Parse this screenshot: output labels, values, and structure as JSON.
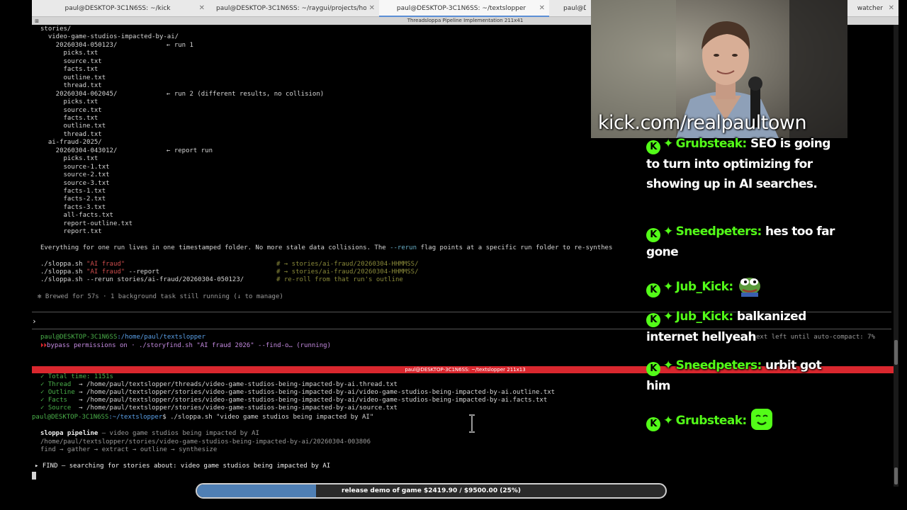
{
  "tabs": [
    {
      "label": "paul@DESKTOP-3C1N6SS: ~/kick",
      "active": false
    },
    {
      "label": "paul@DESKTOP-3C1N6SS: ~/raygui/projects/hoo...",
      "active": false
    },
    {
      "label": "paul@DESKTOP-3C1N6SS: ~/textslopper",
      "active": true
    },
    {
      "label": "paul@DE...",
      "active": false
    },
    {
      "label": "watcher",
      "active": false
    }
  ],
  "window_title": "Threadsloppa Pipeline Implementation 211x41",
  "top_pane": {
    "tree": [
      "stories/",
      "  video-game-studios-impacted-by-ai/",
      "    20260304-050123/",
      "      picks.txt",
      "      source.txt",
      "      facts.txt",
      "      outline.txt",
      "      thread.txt",
      "    20260304-062045/",
      "      picks.txt",
      "      source.txt",
      "      facts.txt",
      "      outline.txt",
      "      thread.txt",
      "  ai-fraud-2025/",
      "    20260304-043012/",
      "      picks.txt",
      "      source-1.txt",
      "      source-2.txt",
      "      source-3.txt",
      "      facts-1.txt",
      "      facts-2.txt",
      "      facts-3.txt",
      "      all-facts.txt",
      "      report-outline.txt",
      "      report.txt"
    ],
    "annotations": [
      {
        "row": 2,
        "text": "← run 1"
      },
      {
        "row": 8,
        "text": "← run 2 (different results, no collision)"
      },
      {
        "row": 15,
        "text": "← report run"
      }
    ],
    "summary_pre": "Everything for one run lives in one timestamped folder. No more stale data collisions. The ",
    "summary_flag": "--rerun",
    "summary_post": " flag points at a specific run folder to re-synthes",
    "commands": [
      {
        "cmd": "./sloppa.sh ",
        "arg": "\"AI fraud\"",
        "extra": "",
        "comment": "# → stories/ai-fraud/20260304-HHMMSS/"
      },
      {
        "cmd": "./sloppa.sh ",
        "arg": "\"AI fraud\"",
        "extra": " --report",
        "comment": "# → stories/ai-fraud/20260304-HHMMSS/"
      },
      {
        "cmd": "./sloppa.sh --rerun stories/ai-fraud/20260304-050123/",
        "arg": "",
        "extra": "",
        "comment": "# re-roll from that run's outline"
      }
    ],
    "brewed": "✻ Brewed for 57s · 1 background task still running (↓ to manage)",
    "prompt_symbol": "›",
    "ps_user": "paul@DESKTOP-3C1N6SS",
    "ps_path": ":/home/paul/textslopper",
    "bypass": "bypass permissions on · ./storyfind.sh \"AI fraud 2026\" --find-o… (running)",
    "context_left": "ext left until auto-compact: 7%"
  },
  "split_title": "paul@DESKTOP-3C1N6SS: ~/textslopper 211x13",
  "bottom_pane": {
    "total_time": "✓ Total time: 1151s",
    "outputs": [
      {
        "label": "✓ Thread ",
        "path": "→ /home/paul/textslopper/threads/video-game-studios-being-impacted-by-ai.thread.txt"
      },
      {
        "label": "✓ Outline",
        "path": "→ /home/paul/textslopper/stories/video-game-studios-being-impacted-by-ai/video-game-studios-being-impacted-by-ai.outline.txt"
      },
      {
        "label": "✓ Facts  ",
        "path": "→ /home/paul/textslopper/stories/video-game-studios-being-impacted-by-ai/video-game-studios-being-impacted-by-ai.facts.txt"
      },
      {
        "label": "✓ Source ",
        "path": "→ /home/paul/textslopper/stories/video-game-studios-being-impacted-by-ai/source.txt"
      }
    ],
    "prompt_user": "paul@DESKTOP-3C1N6SS",
    "prompt_path": ":~/textslopper",
    "prompt_cmd": "$ ./sloppa.sh \"video game studios being impacted by AI\"",
    "pipeline_title": "sloppa pipeline",
    "pipeline_subtitle": " — video game studios being impacted by AI",
    "pipeline_dir": "/home/paul/textslopper/stories/video-game-studios-being-impacted-by-ai/20260304-003806",
    "pipeline_steps": "find → gather → extract → outline → synthesize",
    "find_line": "▸ FIND — searching for stories about: video game studios being impacted by AI"
  },
  "stream": {
    "watermark": "kick.com/realpaultown",
    "chat": [
      {
        "user": "Grubsteak:",
        "msg": "SEO is going to turn into optimizing for showing up in AI searches.",
        "emote": ""
      },
      {
        "user": "Sneedpeters:",
        "msg": "hes too far gone",
        "emote": ""
      },
      {
        "user": "Jub_Kick:",
        "msg": "",
        "emote": "pepe-emote"
      },
      {
        "user": "Jub_Kick:",
        "msg": "balkanized internet hellyeah",
        "emote": ""
      },
      {
        "user": "Sneedpeters:",
        "msg": "urbit got him",
        "emote": ""
      },
      {
        "user": "Grubsteak:",
        "msg": "",
        "emote": "smile-emote"
      }
    ],
    "badge_icon": "kick-k-icon",
    "sparkle_icon": "sparkle-icon"
  },
  "progress": {
    "label": "release demo of game $2419.90 / $9500.00 (25%)",
    "fraction": 0.2547,
    "fill_color": "#4f7fb4"
  },
  "colors": {
    "kick_green": "#53fc18",
    "split_bar": "#d9272e"
  }
}
